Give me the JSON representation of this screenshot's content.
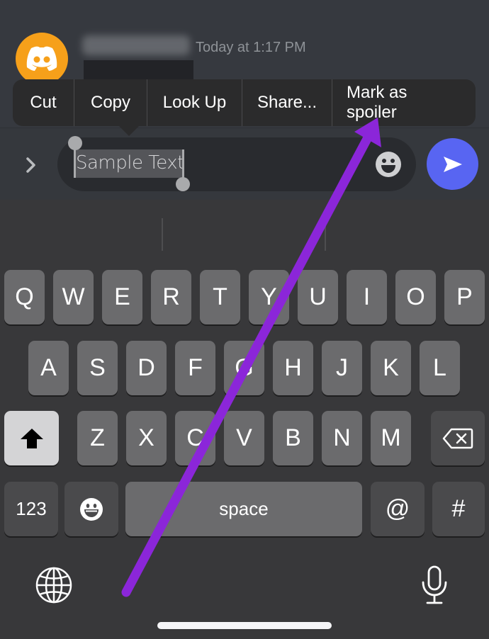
{
  "message": {
    "username": "(blurred)",
    "timestamp": "Today at 1:17 PM",
    "avatar_color": "#f6a01a"
  },
  "context_menu": {
    "items": [
      {
        "label": "Cut"
      },
      {
        "label": "Copy"
      },
      {
        "label": "Look Up"
      },
      {
        "label": "Share..."
      },
      {
        "label": "Mark as spoiler"
      }
    ]
  },
  "composer": {
    "text": "Sample Text",
    "selected_text": "Sample Text",
    "send_color": "#5865f2"
  },
  "keyboard": {
    "row1": [
      "Q",
      "W",
      "E",
      "R",
      "T",
      "Y",
      "U",
      "I",
      "O",
      "P"
    ],
    "row2": [
      "A",
      "S",
      "D",
      "F",
      "G",
      "H",
      "J",
      "K",
      "L"
    ],
    "row3": [
      "Z",
      "X",
      "C",
      "V",
      "B",
      "N",
      "M"
    ],
    "numbers_label": "123",
    "space_label": "space",
    "at_label": "@",
    "hash_label": "#"
  },
  "annotation": {
    "type": "arrow",
    "color": "#8b26d9",
    "points_to": "Mark as spoiler"
  }
}
